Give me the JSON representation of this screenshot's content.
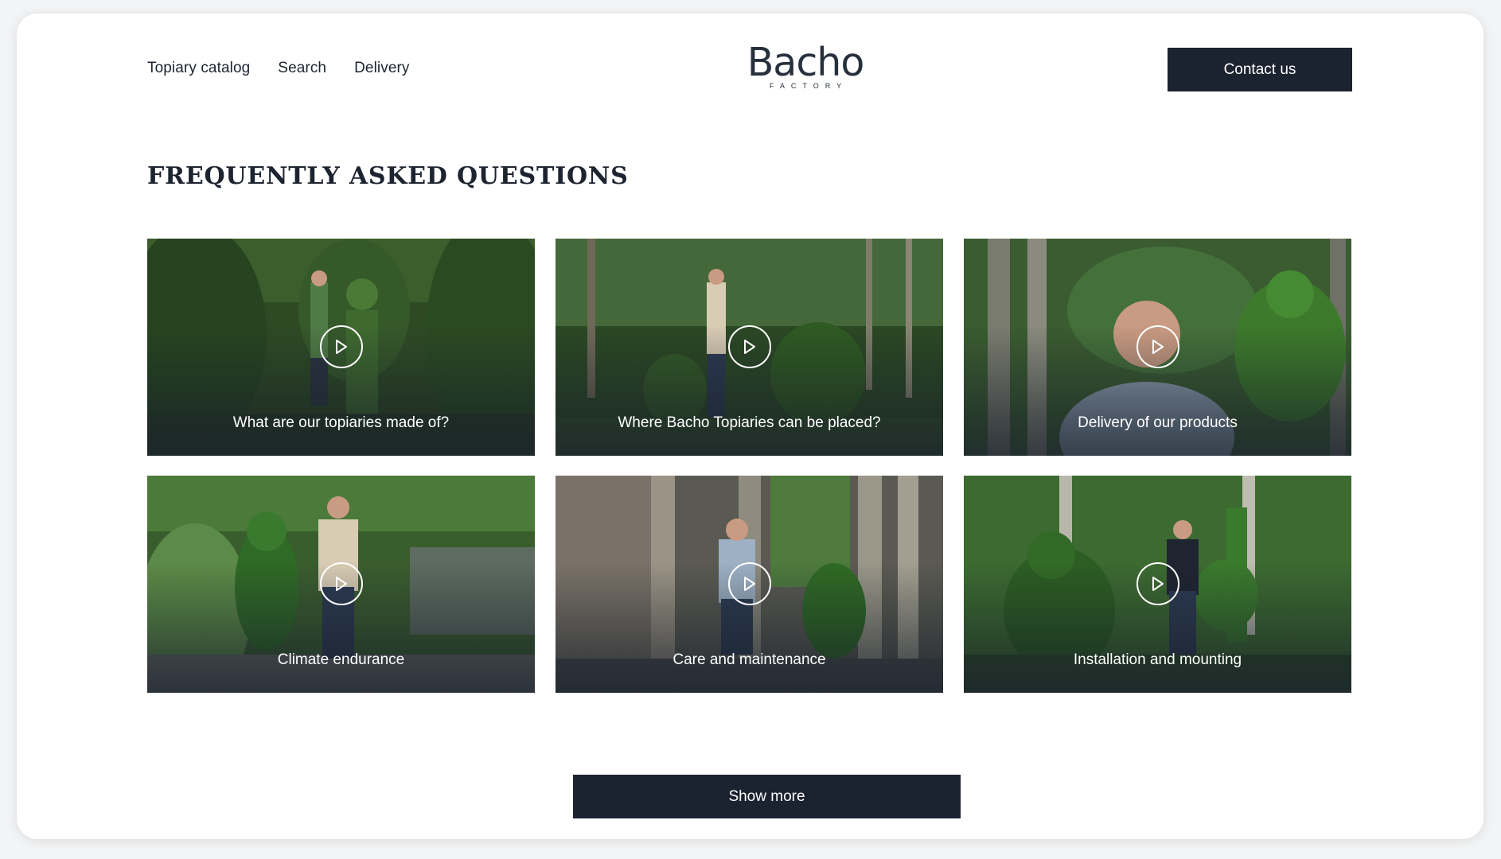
{
  "header": {
    "nav": [
      "Topiary catalog",
      "Search",
      "Delivery"
    ],
    "logo_text": "Bacho",
    "logo_sub": "FACTORY",
    "contact_label": "Contact us"
  },
  "main": {
    "title": "FREQUENTLY ASKED QUESTIONS",
    "videos": [
      {
        "label": "What are our topiaries made of?"
      },
      {
        "label": "Where Bacho Topiaries can be placed?"
      },
      {
        "label": "Delivery of our products"
      },
      {
        "label": "Climate endurance"
      },
      {
        "label": "Care and maintenance"
      },
      {
        "label": "Installation and mounting"
      }
    ],
    "show_more_label": "Show more"
  },
  "colors": {
    "button_bg": "#1b2230",
    "text_dark": "#1d2430",
    "foliage_dark": "#2c4a22",
    "foliage_light": "#4f7a34"
  },
  "icons": {
    "play": "play-icon"
  }
}
